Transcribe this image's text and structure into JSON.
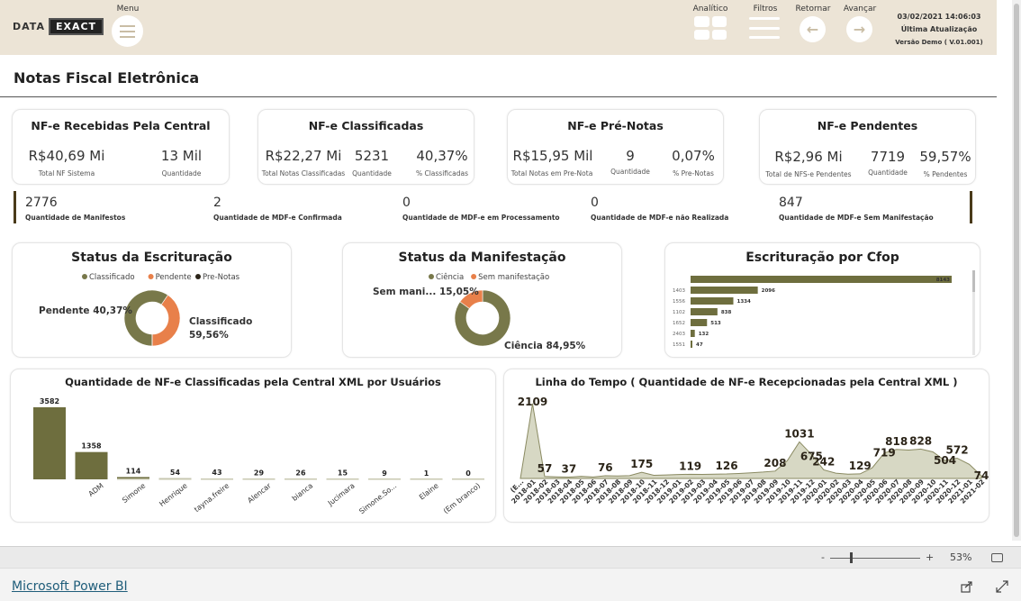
{
  "header": {
    "logo": {
      "left": "DATA",
      "right": "EXACT"
    },
    "menu_label": "Menu",
    "analitico_label": "Analítico",
    "filtros_label": "Filtros",
    "retornar_label": "Retornar",
    "avancar_label": "Avançar",
    "update_datetime": "03/02/2021 14:06:03",
    "update_label": "Última Atualização",
    "version": "Versão Demo ( V.01.001)"
  },
  "page_title": "Notas Fiscal Eletrônica",
  "kpis": {
    "recebidas": {
      "title": "NF-e Recebidas Pela Central",
      "v1": "R$40,69 Mi",
      "l1": "Total NF Sistema",
      "v2": "13 Mil",
      "l2": "Quantidade"
    },
    "classificadas": {
      "title": "NF-e Classificadas",
      "v1": "R$22,27 Mi",
      "l1": "Total Notas Classificadas",
      "v2": "5231",
      "l2": "Quantidade",
      "v3": "40,37%",
      "l3": "% Classificadas"
    },
    "prenotas": {
      "title": "NF-e Pré-Notas",
      "v1": "R$15,95 Mil",
      "l1": "Total Notas em Pre-Nota",
      "v2": "9",
      "l2": "Quantidade",
      "v3": "0,07%",
      "l3": "% Pre-Notas"
    },
    "pendentes": {
      "title": "NF-e Pendentes",
      "v1": "R$2,96 Mi",
      "l1": "Total de NFS-e Pendentes",
      "v2": "7719",
      "l2": "Quantidade",
      "v3": "59,57%",
      "l3": "% Pendentes"
    }
  },
  "manifest_strip": [
    {
      "value": "2776",
      "label": "Quantidade de Manifestos"
    },
    {
      "value": "2",
      "label": "Quantidade de MDF-e Confirmada"
    },
    {
      "value": "0",
      "label": "Quantidade de MDF-e em Processamento"
    },
    {
      "value": "0",
      "label": "Quantidade de MDF-e não Realizada"
    },
    {
      "value": "847",
      "label": "Quantidade de MDF-e Sem Manifestação"
    }
  ],
  "colors": {
    "olive": "#78784a",
    "orange": "#e8804a",
    "dark": "#2b2418",
    "bar": "#6e6e3e",
    "topbar": "#ece4d6"
  },
  "chart_data": [
    {
      "type": "pie",
      "title": "Status da Escrituração",
      "legend": [
        "Classificado",
        "Pendente",
        "Pre-Notas"
      ],
      "values": [
        59.56,
        40.37,
        0.07
      ],
      "data_labels": [
        "Classificado",
        "59,56%",
        "Pendente 40,37%"
      ]
    },
    {
      "type": "pie",
      "title": "Status da Manifestação",
      "legend": [
        "Ciência",
        "Sem manifestação"
      ],
      "values": [
        84.95,
        15.05
      ],
      "data_labels": [
        "Ciência 84,95%",
        "Sem mani... 15,05%"
      ]
    },
    {
      "type": "bar",
      "title": "Escrituração por Cfop",
      "categories": [
        "",
        "1403",
        "1556",
        "1102",
        "1652",
        "2403",
        "1551"
      ],
      "values": [
        8143,
        2096,
        1334,
        838,
        513,
        132,
        47
      ],
      "value_labels": [
        "8143",
        "2096",
        "1334",
        "838",
        "513",
        "132",
        "47"
      ]
    },
    {
      "type": "bar",
      "title": "Quantidade de NF-e Classificadas pela Central XML por Usuários",
      "categories": [
        "",
        "ADM",
        "Simone",
        "Henrique",
        "tayna.freire",
        "Alencar",
        "bianca",
        "Jucimara",
        "Simone.So...",
        "Elaine",
        "(Em branco)"
      ],
      "values": [
        3582,
        1358,
        114,
        54,
        43,
        29,
        26,
        15,
        9,
        1,
        0
      ],
      "value_labels": [
        "3582",
        "1358",
        "114",
        "54",
        "43",
        "29",
        "26",
        "15",
        "9",
        "1",
        "0"
      ]
    },
    {
      "type": "area",
      "title": "Linha do Tempo ( Quantidade de NF-e Recepcionadas pela Central XML )",
      "x": [
        "(E...",
        "2018-01",
        "2018-02",
        "2018-03",
        "2018-04",
        "2018-05",
        "2018-06",
        "2018-07",
        "2018-08",
        "2018-09",
        "2018-10",
        "2018-11",
        "2018-12",
        "2019-01",
        "2019-02",
        "2019-03",
        "2019-04",
        "2019-05",
        "2019-06",
        "2019-07",
        "2019-08",
        "2019-09",
        "2019-10",
        "2019-11",
        "2019-12",
        "2020-01",
        "2020-02",
        "2020-03",
        "2020-04",
        "2020-05",
        "2020-06",
        "2020-07",
        "2020-08",
        "2020-09",
        "2020-10",
        "2020-11",
        "2020-12",
        "2021-01",
        "2021-02"
      ],
      "values": [
        0,
        2109,
        57,
        45,
        37,
        60,
        40,
        76,
        70,
        80,
        175,
        90,
        100,
        110,
        119,
        115,
        120,
        126,
        140,
        160,
        180,
        208,
        500,
        1031,
        675,
        242,
        150,
        120,
        129,
        300,
        719,
        818,
        800,
        828,
        750,
        504,
        572,
        400,
        74
      ],
      "value_labels": [
        {
          "i": 1,
          "label": "2109"
        },
        {
          "i": 2,
          "label": "57"
        },
        {
          "i": 4,
          "label": "37"
        },
        {
          "i": 7,
          "label": "76"
        },
        {
          "i": 10,
          "label": "175"
        },
        {
          "i": 14,
          "label": "119"
        },
        {
          "i": 17,
          "label": "126"
        },
        {
          "i": 21,
          "label": "208"
        },
        {
          "i": 23,
          "label": "1031"
        },
        {
          "i": 24,
          "label": "675"
        },
        {
          "i": 25,
          "label": "242"
        },
        {
          "i": 28,
          "label": "129"
        },
        {
          "i": 30,
          "label": "719"
        },
        {
          "i": 31,
          "label": "818"
        },
        {
          "i": 33,
          "label": "828"
        },
        {
          "i": 35,
          "label": "504"
        },
        {
          "i": 36,
          "label": "572"
        },
        {
          "i": 38,
          "label": "74"
        }
      ]
    }
  ],
  "statusbar": {
    "zoom_minus": "-",
    "zoom_plus": "+",
    "zoom_level": "53%"
  },
  "footer": {
    "link": "Microsoft Power BI"
  }
}
